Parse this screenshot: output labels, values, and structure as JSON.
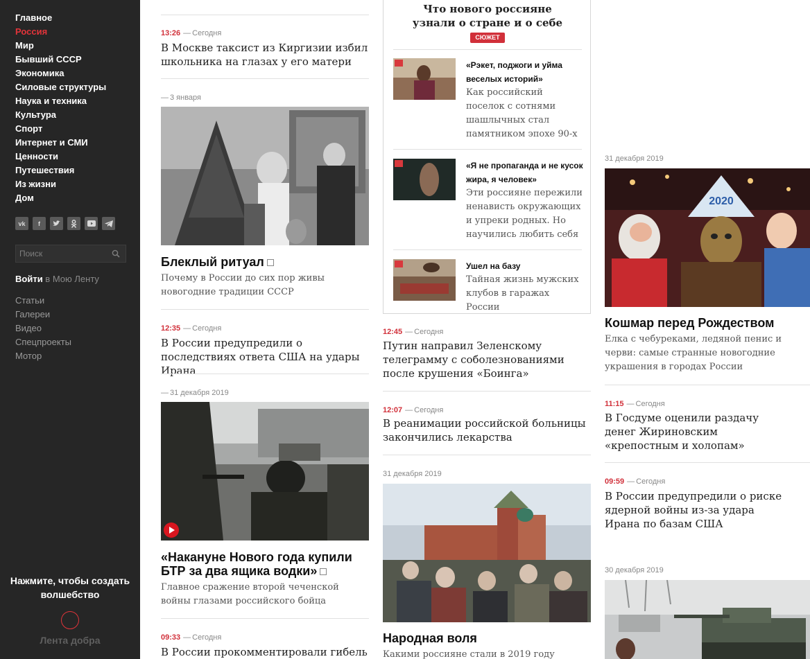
{
  "sidebar": {
    "nav": [
      "Главное",
      "Россия",
      "Мир",
      "Бывший СССР",
      "Экономика",
      "Силовые структуры",
      "Наука и техника",
      "Культура",
      "Спорт",
      "Интернет и СМИ",
      "Ценности",
      "Путешествия",
      "Из жизни",
      "Дом"
    ],
    "active_item": "Россия",
    "socials": [
      "vk-icon",
      "facebook-icon",
      "twitter-icon",
      "odnoklassniki-icon",
      "youtube-icon",
      "telegram-icon"
    ],
    "search_placeholder": "Поиск",
    "login_link": "Войти",
    "login_suffix": " в Мою Ленту",
    "subnav": [
      "Статьи",
      "Галереи",
      "Видео",
      "Спецпроекты",
      "Мотор"
    ],
    "promo_text": "Нажмите, чтобы создать волшебство",
    "promo_label": "Лента добра"
  },
  "col1": {
    "n1": {
      "time": "13:26",
      "date": "Сегодня",
      "title": "В Москве таксист из Киргизии избил школьника на глазах у его матери"
    },
    "r1": {
      "date": "3 января",
      "title": "Блеклый ритуал",
      "lead": "Почему в России до сих пор живы новогодние традиции СССР"
    },
    "n2": {
      "time": "12:35",
      "date": "Сегодня",
      "title": "В России предупредили о последствиях ответа США на удары Ирана"
    },
    "r2": {
      "date": "31 декабря 2019",
      "title": "«Накануне Нового года купили БТР за два ящика водки»",
      "lead": "Главное сражение второй чеченской войны глазами российского бойца"
    },
    "n3": {
      "time": "09:33",
      "date": "Сегодня",
      "title": "В России прокомментировали гибель"
    }
  },
  "story": {
    "title": "Что нового россияне узнали о стране и о себе",
    "badge": "СЮЖЕТ",
    "items": [
      {
        "title": "«Рэкет, поджоги и уйма веселых историй»",
        "desc": "Как российский поселок с сотнями шашлычных стал памятником эпохе 90-х"
      },
      {
        "title": "«Я не пропаганда и не кусок жира, я человек»",
        "desc": "Эти россияне пережили ненависть окружающих и упреки родных. Но научились любить себя"
      },
      {
        "title": "Ушел на базу",
        "desc": "Тайная жизнь мужских клубов в гаражах России"
      }
    ]
  },
  "col2": {
    "n1": {
      "time": "12:45",
      "date": "Сегодня",
      "title": "Путин направил Зеленскому телеграмму с соболезнованиями после крушения «Боинга»"
    },
    "n2": {
      "time": "12:07",
      "date": "Сегодня",
      "title": "В реанимации российской больницы закончились лекарства"
    },
    "r1": {
      "date": "31 декабря 2019",
      "title": "Народная воля",
      "lead": "Какими россияне стали в 2019 году"
    }
  },
  "col3": {
    "r1": {
      "date": "31 декабря 2019",
      "title": "Кошмар перед Рождеством",
      "lead": "Елка с чебуреками, ледяной пенис и черви: самые странные новогодние украшения в городах России",
      "photo_label": "2020"
    },
    "n1": {
      "time": "11:15",
      "date": "Сегодня",
      "title": "В Госдуме оценили раздачу денег Жириновским «крепостным и холопам»"
    },
    "n2": {
      "time": "09:59",
      "date": "Сегодня",
      "title": "В России предупредили о риске ядерной войны из-за удара Ирана по базам США"
    },
    "r2": {
      "date": "30 декабря 2019"
    }
  },
  "colors": {
    "sidebar_bg": "#262626",
    "accent": "#d1303a",
    "nav_active": "#e2343a"
  }
}
